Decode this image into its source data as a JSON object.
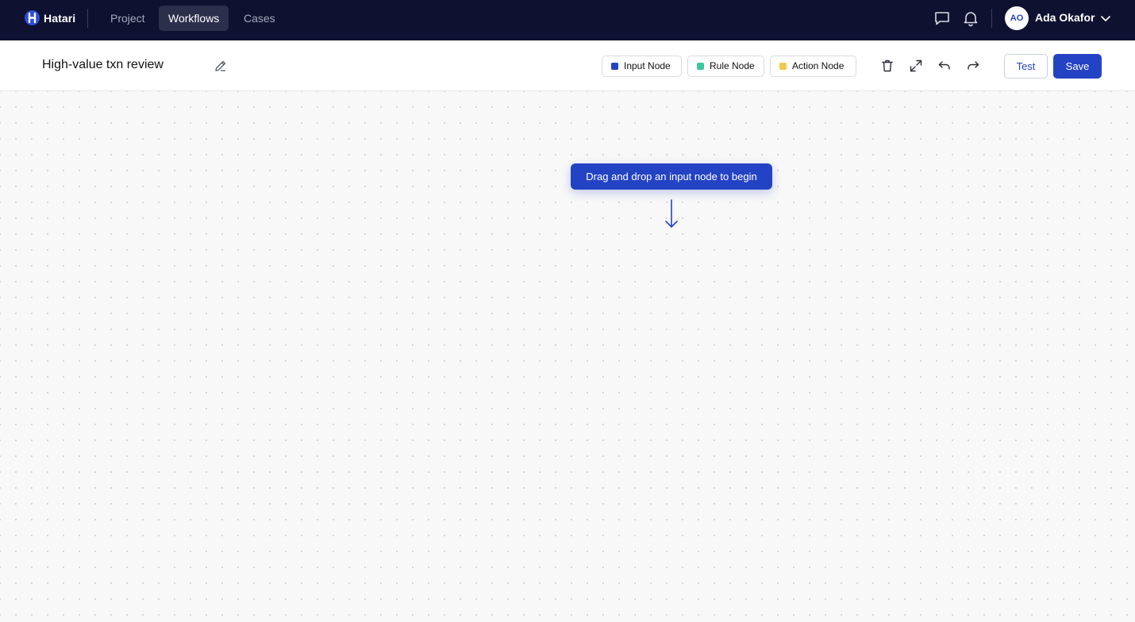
{
  "nav": {
    "brand": "Hatari",
    "links": [
      "Project",
      "Workflows",
      "Cases"
    ],
    "active_link": "Workflows",
    "user": {
      "initials": "AO",
      "name": "Ada Okafor"
    },
    "icons": [
      "chat-icon",
      "bell-icon",
      "chevron-down-icon"
    ]
  },
  "toolbar": {
    "title": "High-value txn review",
    "node_types": [
      {
        "label": "Input Node",
        "color": "#2443c4"
      },
      {
        "label": "Rule Node",
        "color": "#3ec6a0"
      },
      {
        "label": "Action Node",
        "color": "#f2c94c"
      }
    ],
    "icons": [
      "trash-icon",
      "expand-icon",
      "undo-icon",
      "redo-icon"
    ],
    "test_label": "Test",
    "save_label": "Save"
  },
  "canvas": {
    "hint": "Drag and drop an input node to begin"
  },
  "colors": {
    "nav_bg": "#0f1130",
    "accent": "#2443c4"
  }
}
